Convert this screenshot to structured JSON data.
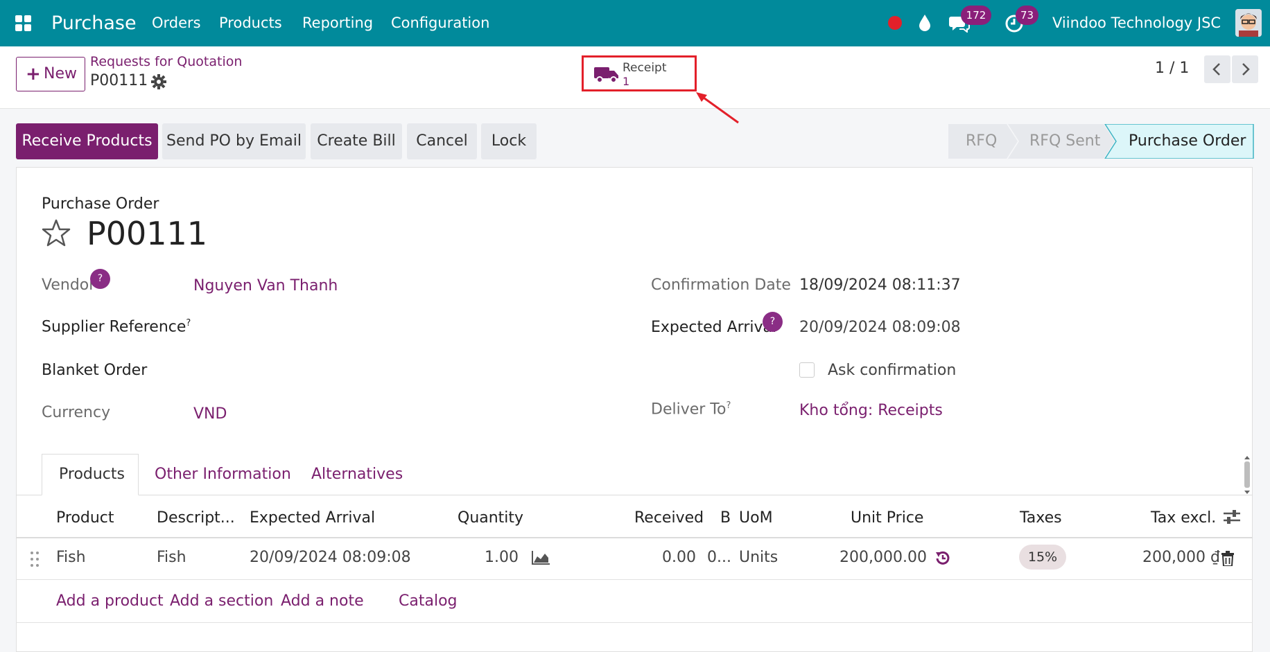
{
  "topbar": {
    "app_name": "Purchase",
    "menus": [
      "Orders",
      "Products",
      "Reporting",
      "Configuration"
    ],
    "messages_count": "172",
    "activities_count": "73",
    "company": "Viindoo Technology JSC",
    "color": "#018a9b"
  },
  "control": {
    "new_label": "New",
    "breadcrumb_parent": "Requests for Quotation",
    "record_name": "P00111",
    "smart_button": {
      "label": "Receipt",
      "count": "1"
    },
    "pager": "1 / 1"
  },
  "actions": {
    "receive": "Receive Products",
    "send_email": "Send PO by Email",
    "create_bill": "Create Bill",
    "cancel": "Cancel",
    "lock": "Lock"
  },
  "statusbar": [
    "RFQ",
    "RFQ Sent",
    "Purchase Order"
  ],
  "form": {
    "type_label": "Purchase Order",
    "title": "P00111",
    "vendor_label": "Vendor",
    "vendor_value": "Nguyen Van Thanh",
    "supplier_ref_label": "Supplier Reference",
    "blanket_label": "Blanket Order",
    "currency_label": "Currency",
    "currency_value": "VND",
    "confirm_date_label": "Confirmation Date",
    "confirm_date_value": "18/09/2024 08:11:37",
    "expected_label": "Expected Arrival",
    "expected_value": "20/09/2024 08:09:08",
    "ask_confirm_label": "Ask confirmation",
    "deliver_label": "Deliver To",
    "deliver_value": "Kho tổng: Receipts"
  },
  "tabs": [
    "Products",
    "Other Information",
    "Alternatives"
  ],
  "lines": {
    "headers": [
      "Product",
      "Descript...",
      "Expected Arrival",
      "Quantity",
      "Received",
      "B",
      "UoM",
      "Unit Price",
      "Taxes",
      "Tax excl."
    ],
    "rows": [
      {
        "product": "Fish",
        "description": "Fish",
        "expected": "20/09/2024 08:09:08",
        "quantity": "1.00",
        "received": "0.00",
        "b": "0...",
        "uom": "Units",
        "price": "200,000.00",
        "tax": "15%",
        "subtotal": "200,000 ₫"
      }
    ],
    "add_product": "Add a product",
    "add_section": "Add a section",
    "add_note": "Add a note",
    "catalog": "Catalog"
  },
  "help_mark": "?",
  "sup_mark": "?",
  "colors": {
    "primary": "#714b67",
    "nav": "#018a9b",
    "highlight": "#e3202a",
    "active_stage": "#dcf6f9"
  }
}
